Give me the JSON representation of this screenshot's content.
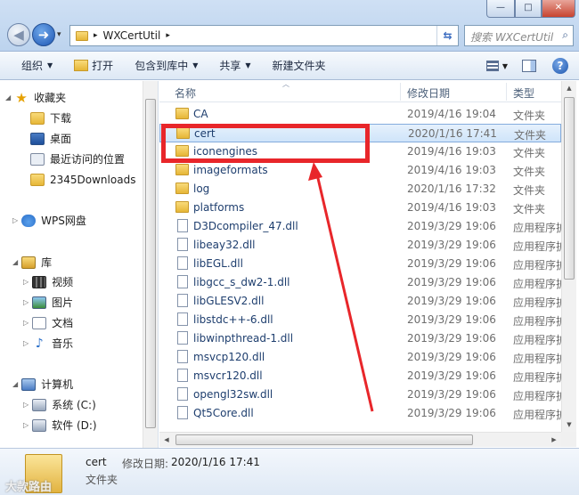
{
  "window": {
    "min": "—",
    "max": "□",
    "close": "✕"
  },
  "nav": {
    "back": "◀",
    "forward": "➜",
    "drop": "▾"
  },
  "address": {
    "crumb": "WXCertUtil",
    "sep": "▸",
    "refresh": "⇆"
  },
  "search": {
    "placeholder": "搜索 WXCertUtil",
    "icon": "⌕"
  },
  "toolbar": {
    "organize": "组织",
    "open": "打开",
    "include": "包含到库中",
    "share": "共享",
    "new_folder": "新建文件夹",
    "help": "?"
  },
  "sidebar": {
    "favorites": "收藏夹",
    "downloads": "下载",
    "desktop": "桌面",
    "recent": "最近访问的位置",
    "d2345": "2345Downloads",
    "wps": "WPS网盘",
    "libraries": "库",
    "video": "视频",
    "pictures": "图片",
    "documents": "文档",
    "music": "音乐",
    "computer": "计算机",
    "c_drive": "系统 (C:)",
    "d_drive": "软件 (D:)"
  },
  "columns": {
    "name": "名称",
    "date": "修改日期",
    "type": "类型"
  },
  "files": [
    {
      "name": "CA",
      "date": "2019/4/16 19:04",
      "type": "文件夹",
      "kind": "folder"
    },
    {
      "name": "cert",
      "date": "2020/1/16 17:41",
      "type": "文件夹",
      "kind": "folder"
    },
    {
      "name": "iconengines",
      "date": "2019/4/16 19:03",
      "type": "文件夹",
      "kind": "folder"
    },
    {
      "name": "imageformats",
      "date": "2019/4/16 19:03",
      "type": "文件夹",
      "kind": "folder"
    },
    {
      "name": "log",
      "date": "2020/1/16 17:32",
      "type": "文件夹",
      "kind": "folder"
    },
    {
      "name": "platforms",
      "date": "2019/4/16 19:03",
      "type": "文件夹",
      "kind": "folder"
    },
    {
      "name": "D3Dcompiler_47.dll",
      "date": "2019/3/29 19:06",
      "type": "应用程序扩",
      "kind": "dll"
    },
    {
      "name": "libeay32.dll",
      "date": "2019/3/29 19:06",
      "type": "应用程序扩",
      "kind": "dll"
    },
    {
      "name": "libEGL.dll",
      "date": "2019/3/29 19:06",
      "type": "应用程序扩",
      "kind": "dll"
    },
    {
      "name": "libgcc_s_dw2-1.dll",
      "date": "2019/3/29 19:06",
      "type": "应用程序扩",
      "kind": "dll"
    },
    {
      "name": "libGLESV2.dll",
      "date": "2019/3/29 19:06",
      "type": "应用程序扩",
      "kind": "dll"
    },
    {
      "name": "libstdc++-6.dll",
      "date": "2019/3/29 19:06",
      "type": "应用程序扩",
      "kind": "dll"
    },
    {
      "name": "libwinpthread-1.dll",
      "date": "2019/3/29 19:06",
      "type": "应用程序扩",
      "kind": "dll"
    },
    {
      "name": "msvcp120.dll",
      "date": "2019/3/29 19:06",
      "type": "应用程序扩",
      "kind": "dll"
    },
    {
      "name": "msvcr120.dll",
      "date": "2019/3/29 19:06",
      "type": "应用程序扩",
      "kind": "dll"
    },
    {
      "name": "opengl32sw.dll",
      "date": "2019/3/29 19:06",
      "type": "应用程序扩",
      "kind": "dll"
    },
    {
      "name": "Qt5Core.dll",
      "date": "2019/3/29 19:06",
      "type": "应用程序扩",
      "kind": "dll"
    }
  ],
  "selected_index": 1,
  "details": {
    "name": "cert",
    "modified_label": "修改日期:",
    "modified_value": "2020/1/16 17:41",
    "type": "文件夹"
  },
  "watermark": "大款路由",
  "annotation_color": "#e8262a"
}
